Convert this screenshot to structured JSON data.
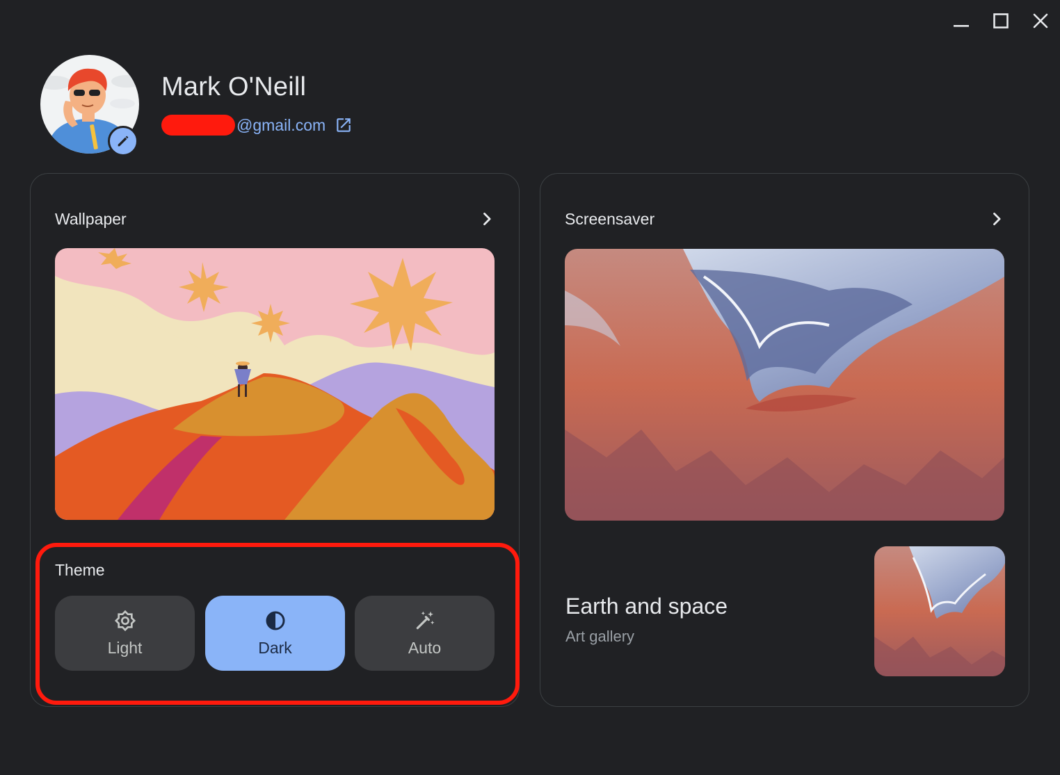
{
  "profile": {
    "name": "Mark O'Neill",
    "email_domain": "@gmail.com"
  },
  "icons": {
    "minimize": "minimize-icon",
    "maximize": "maximize-icon",
    "close": "close-icon",
    "edit": "pencil-icon",
    "external_link": "open-in-new-icon",
    "chevron": "chevron-right-icon",
    "light": "brightness-icon",
    "dark": "contrast-icon",
    "auto": "magic-wand-icon"
  },
  "wallpaper": {
    "title": "Wallpaper"
  },
  "screensaver": {
    "title": "Screensaver",
    "album_title": "Earth and space",
    "album_subtitle": "Art gallery"
  },
  "theme": {
    "label": "Theme",
    "options": [
      {
        "label": "Light",
        "selected": false
      },
      {
        "label": "Dark",
        "selected": true
      },
      {
        "label": "Auto",
        "selected": false
      }
    ]
  },
  "colors": {
    "background": "#202124",
    "accent": "#8ab4f8",
    "highlight": "#ff1a0d"
  }
}
